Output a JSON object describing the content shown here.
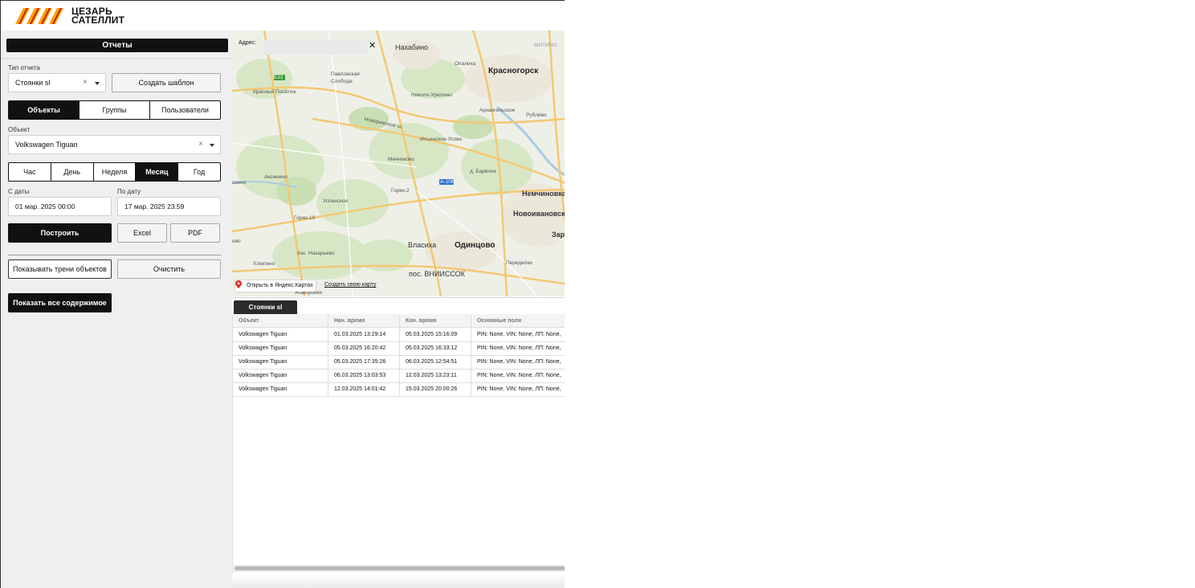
{
  "brand": {
    "line1": "ЦЕЗАРЬ",
    "line2": "САТЕЛЛИТ",
    "stripe_color": "#f5a300",
    "stripe_accent": "#d11010"
  },
  "sidebar": {
    "title": "Отчеты",
    "report_type": {
      "label": "Тип отчета",
      "value": "Стоянки sl"
    },
    "create_template": "Создать шаблон",
    "entity_tabs": {
      "items": [
        "Объекты",
        "Группы",
        "Пользователи"
      ],
      "active": 0
    },
    "object": {
      "label": "Объект",
      "value": "Volkswagen Tiguan"
    },
    "period_tabs": {
      "items": [
        "Час",
        "День",
        "Неделя",
        "Месяц",
        "Год"
      ],
      "active": 3
    },
    "from": {
      "label": "С даты",
      "value": "01 мар. 2025 00:00"
    },
    "to": {
      "label": "По дату",
      "value": "17 мар. 2025 23:59"
    },
    "build": "Построить",
    "excel": "Excel",
    "pdf": "PDF",
    "show_tracks": "Показывать трени объектов",
    "clear": "Очистить",
    "show_all": "Показать все содержимое"
  },
  "map": {
    "address_label": "Адрес:",
    "close_symbol": "✕",
    "open_in_yandex": "Открыть в Яндекс.Картах",
    "create_map": "Создать свою карту",
    "places": {
      "nakhabino": "Нахабино",
      "opalikha": "Опалиха",
      "krasnogorsk": "Красногорск",
      "mitino": "МИТИНО",
      "pavlovskaya": "Павловская\nСлобода",
      "krasny": "Красный Посёлок",
      "nikolo": "Николо-Урюпино",
      "arkhangelskoe": "Архангельское",
      "rublevo": "Рублёво",
      "novorizhskoe": "Новорижское ш.",
      "ilinskoe": "Ильинское-Усово",
      "mechnikovo": "Мечниково",
      "barvikha": "д. Барвиха",
      "nemchinovka": "Немчиновка",
      "aksinino": "Аксинино",
      "gorki2": "Горки-2",
      "uspenskoe": "Успенское",
      "novoivanovskoe": "Новоивановское",
      "gorki10": "Горки-10",
      "vlasikha": "Власиха",
      "odintsovo": "Одинцово",
      "zar": "Зар",
      "nazarevo": "пос. Назарьево",
      "khlopino": "Хлюпино",
      "peredelki": "Переделки",
      "vniissok": "пос. ВНИИССОК",
      "zhavoronki": "Жаворонки",
      "ozino": "озино",
      "evo": "ево",
      "a106": "A-106",
      "e22": "E22"
    }
  },
  "report": {
    "tab": "Стоянки sl",
    "columns": [
      "Объект",
      "Нач. время",
      "Кон. время",
      "Основные поля"
    ],
    "rows": [
      [
        "Volkswagen Tiguan",
        "01.03.2025 13:29:14",
        "05.03.2025 15:16:09",
        "PIN: None, VIN: None, ЛП: None,"
      ],
      [
        "Volkswagen Tiguan",
        "05.03.2025 16:20:42",
        "05.03.2025 16:33:12",
        "PIN: None, VIN: None, ЛП: None,"
      ],
      [
        "Volkswagen Tiguan",
        "05.03.2025 17:35:26",
        "06.03.2025 12:54:51",
        "PIN: None, VIN: None, ЛП: None,"
      ],
      [
        "Volkswagen Tiguan",
        "06.03.2025 13:03:53",
        "12.03.2025 13:23:11",
        "PIN: None, VIN: None, ЛП: None,"
      ],
      [
        "Volkswagen Tiguan",
        "12.03.2025 14:01:42",
        "15.03.2025 20:00:26",
        "PIN: None, VIN: None, ЛП: None,"
      ]
    ]
  }
}
